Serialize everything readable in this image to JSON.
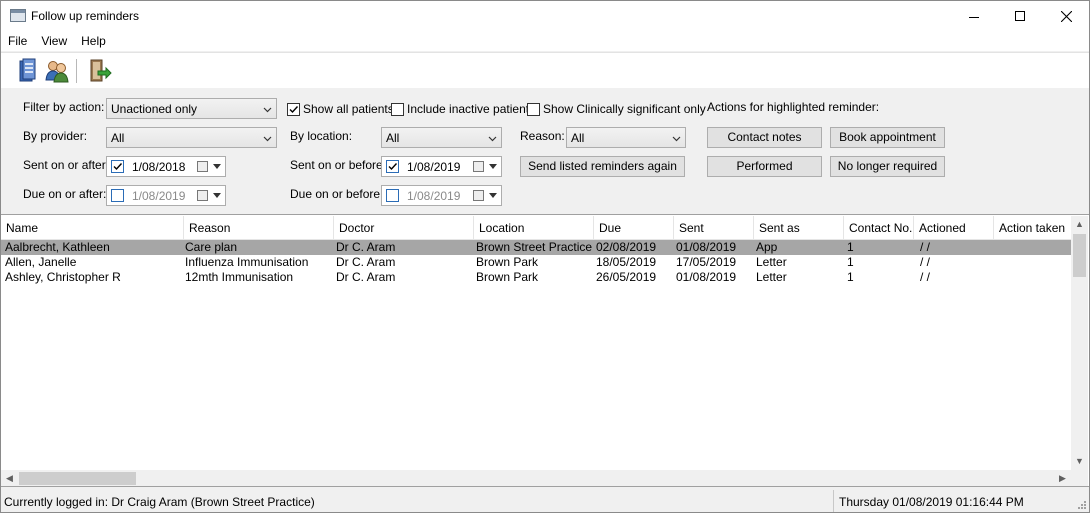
{
  "window": {
    "title": "Follow up reminders"
  },
  "menu": [
    "File",
    "View",
    "Help"
  ],
  "toolbar": {
    "icons": [
      "server-icon",
      "users-icon",
      "exit-icon"
    ]
  },
  "filters": {
    "filter_by_action_label": "Filter by action:",
    "filter_by_action_value": "Unactioned only",
    "show_all_patients_label": "Show all patients",
    "show_all_patients_checked": true,
    "include_inactive_label": "Include inactive patients",
    "include_inactive_checked": false,
    "show_clinically_significant_label": "Show Clinically significant only",
    "show_clinically_significant_checked": false,
    "by_provider_label": "By provider:",
    "by_provider_value": "All",
    "by_location_label": "By location:",
    "by_location_value": "All",
    "reason_label": "Reason:",
    "reason_value": "All",
    "sent_on_after_label": "Sent on or after:",
    "sent_on_after_checked": true,
    "sent_on_after_value": "1/08/2018",
    "sent_on_before_label": "Sent on or before:",
    "sent_on_before_checked": true,
    "sent_on_before_value": "1/08/2019",
    "due_on_after_label": "Due on or after:",
    "due_on_after_checked": false,
    "due_on_after_value": "1/08/2019",
    "due_on_before_label": "Due on or before:",
    "due_on_before_checked": false,
    "due_on_before_value": "1/08/2019"
  },
  "actions": {
    "heading": "Actions for highlighted reminder:",
    "contact_notes": "Contact notes",
    "book_appointment": "Book appointment",
    "performed": "Performed",
    "no_longer_required": "No longer required",
    "send_again": "Send listed reminders again"
  },
  "grid": {
    "columns": [
      "Name",
      "Reason",
      "Doctor",
      "Location",
      "Due",
      "Sent",
      "Sent as",
      "Contact No.",
      "Actioned",
      "Action taken"
    ],
    "rows": [
      [
        "Aalbrecht, Kathleen",
        "Care plan",
        "Dr C. Aram",
        "Brown Street Practice",
        "02/08/2019",
        "01/08/2019",
        "App",
        "1",
        "/ /",
        ""
      ],
      [
        "Allen, Janelle",
        "Influenza Immunisation",
        "Dr C. Aram",
        "Brown Park",
        "18/05/2019",
        "17/05/2019",
        "Letter",
        "1",
        "/ /",
        ""
      ],
      [
        "Ashley, Christopher R",
        "12mth Immunisation",
        "Dr C. Aram",
        "Brown Park",
        "26/05/2019",
        "01/08/2019",
        "Letter",
        "1",
        "/ /",
        ""
      ]
    ],
    "selected_row": 0
  },
  "status": {
    "left": "Currently logged in:  Dr Craig Aram (Brown Street Practice)",
    "right": "Thursday 01/08/2019 01:16:44 PM"
  }
}
